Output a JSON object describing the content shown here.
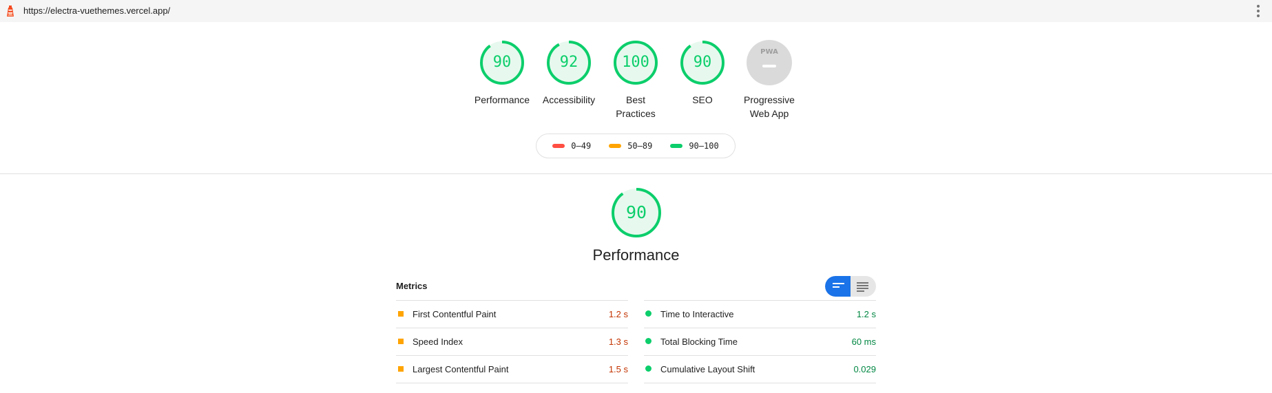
{
  "topbar": {
    "url": "https://electra-vuethemes.vercel.app/",
    "logo_icon": "lighthouse-icon",
    "menu_icon": "more-vert-icon"
  },
  "gauges": [
    {
      "label": "Performance",
      "score": "90",
      "fraction": 0.9,
      "color": "#0cce6b"
    },
    {
      "label": "Accessibility",
      "score": "92",
      "fraction": 0.92,
      "color": "#0cce6b"
    },
    {
      "label": "Best Practices",
      "score": "100",
      "fraction": 1.0,
      "color": "#0cce6b"
    },
    {
      "label": "SEO",
      "score": "90",
      "fraction": 0.9,
      "color": "#0cce6b"
    },
    {
      "label": "Progressive Web App",
      "badge_text": "PWA",
      "color": "#cccccc"
    }
  ],
  "legend": [
    {
      "label": "0–49",
      "color": "#ff4e42"
    },
    {
      "label": "50–89",
      "color": "#ffa400"
    },
    {
      "label": "90–100",
      "color": "#0cce6b"
    }
  ],
  "performance": {
    "score": "90",
    "fraction": 0.9,
    "title": "Performance"
  },
  "metrics": {
    "title": "Metrics",
    "left": [
      {
        "name": "First Contentful Paint",
        "value": "1.2 s",
        "status": "average"
      },
      {
        "name": "Speed Index",
        "value": "1.3 s",
        "status": "average"
      },
      {
        "name": "Largest Contentful Paint",
        "value": "1.5 s",
        "status": "average"
      }
    ],
    "right": [
      {
        "name": "Time to Interactive",
        "value": "1.2 s",
        "status": "pass"
      },
      {
        "name": "Total Blocking Time",
        "value": "60 ms",
        "status": "pass"
      },
      {
        "name": "Cumulative Layout Shift",
        "value": "0.029",
        "status": "pass"
      }
    ]
  },
  "colors": {
    "pass": "#0cce6b",
    "average": "#ffa400",
    "fail": "#ff4e42",
    "accent": "#1a73e8"
  }
}
